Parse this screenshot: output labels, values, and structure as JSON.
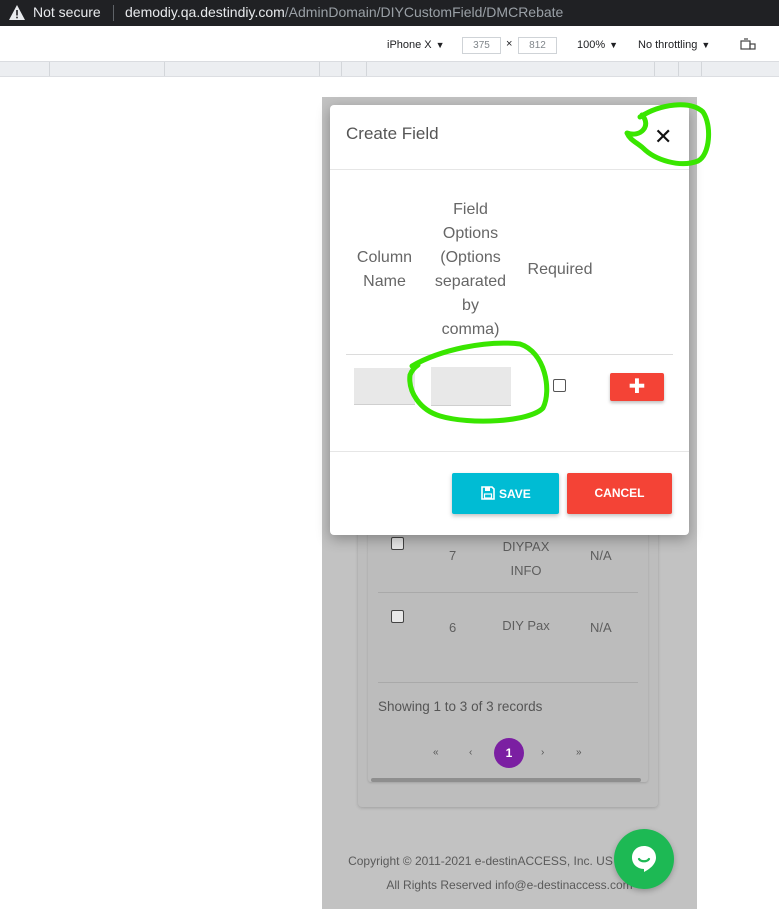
{
  "browser": {
    "security_label": "Not secure",
    "url_host": "demodiy.qa.destindiy.com",
    "url_path": "/AdminDomain/DIYCustomField/DMCRebate"
  },
  "devtools": {
    "device": "iPhone X",
    "width": "375",
    "times": "×",
    "height": "812",
    "zoom": "100%",
    "throttling": "No throttling"
  },
  "modal": {
    "title": "Create Field",
    "close_glyph": "✕",
    "headers": {
      "column_name": [
        "Column",
        "Name"
      ],
      "field_options": [
        "Field",
        "Options",
        "(Options",
        "separated",
        "by",
        "comma)"
      ],
      "required": "Required"
    },
    "add_glyph": "✚",
    "save_label": "SAVE",
    "cancel_label": "CANCEL"
  },
  "table": {
    "rows": [
      {
        "num": "7",
        "name": [
          "DIYPAX",
          "INFO"
        ],
        "value": "N/A"
      },
      {
        "num": "6",
        "name": [
          "DIY Pax"
        ],
        "value": "N/A"
      }
    ],
    "showing": "Showing 1 to 3 of 3 records"
  },
  "pagination": {
    "first": "«",
    "prev": "‹",
    "current": "1",
    "next": "›",
    "last": "»"
  },
  "footer": {
    "line1": "Copyright © 2011-2021 e-destinACCESS, Inc. US Pat 2,331,",
    "line2": "All Rights Reserved info@e-destinaccess.com"
  },
  "colors": {
    "accent_cyan": "#00bcd4",
    "danger_red": "#f44336",
    "page_active": "#7b1fa2",
    "chat_green": "#1db954",
    "annotation_green": "#39e600"
  }
}
